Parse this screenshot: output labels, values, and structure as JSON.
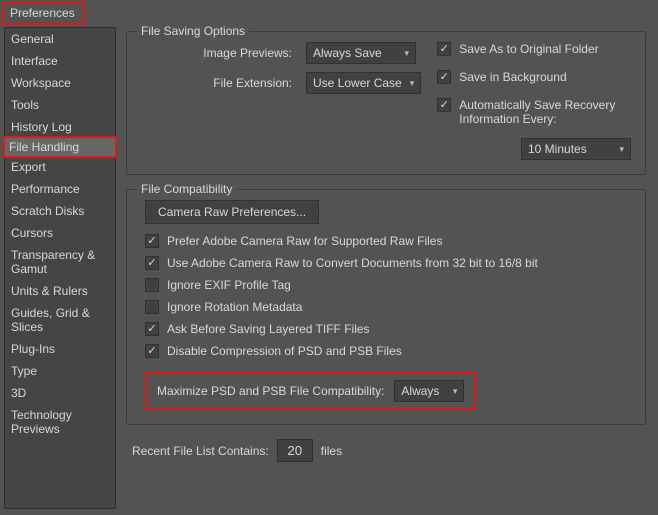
{
  "window": {
    "title": "Preferences"
  },
  "sidebar": {
    "items": [
      {
        "label": "General"
      },
      {
        "label": "Interface"
      },
      {
        "label": "Workspace"
      },
      {
        "label": "Tools"
      },
      {
        "label": "History Log"
      },
      {
        "label": "File Handling"
      },
      {
        "label": "Export"
      },
      {
        "label": "Performance"
      },
      {
        "label": "Scratch Disks"
      },
      {
        "label": "Cursors"
      },
      {
        "label": "Transparency & Gamut"
      },
      {
        "label": "Units & Rulers"
      },
      {
        "label": "Guides, Grid & Slices"
      },
      {
        "label": "Plug-Ins"
      },
      {
        "label": "Type"
      },
      {
        "label": "3D"
      },
      {
        "label": "Technology Previews"
      }
    ],
    "selectedIndex": 5
  },
  "fileSaving": {
    "groupLabel": "File Saving Options",
    "imagePreviewsLabel": "Image Previews:",
    "imagePreviewsValue": "Always Save",
    "fileExtensionLabel": "File Extension:",
    "fileExtensionValue": "Use Lower Case",
    "saveAsOriginalLabel": "Save As to Original Folder",
    "saveInBgLabel": "Save in Background",
    "autoSaveLabel": "Automatically Save Recovery Information Every:",
    "autoSaveInterval": "10 Minutes"
  },
  "fileCompat": {
    "groupLabel": "File Compatibility",
    "cameraRawBtn": "Camera Raw Preferences...",
    "preferACRLabel": "Prefer Adobe Camera Raw for Supported Raw Files",
    "useACRConvertLabel": "Use Adobe Camera Raw to Convert Documents from 32 bit to 16/8 bit",
    "ignoreExifLabel": "Ignore EXIF Profile Tag",
    "ignoreRotationLabel": "Ignore Rotation Metadata",
    "askTiffLabel": "Ask Before Saving Layered TIFF Files",
    "disableCompressLabel": "Disable Compression of PSD and PSB Files",
    "maxCompatLabel": "Maximize PSD and PSB File Compatibility:",
    "maxCompatValue": "Always"
  },
  "recent": {
    "label": "Recent File List Contains:",
    "value": "20",
    "suffix": "files"
  }
}
